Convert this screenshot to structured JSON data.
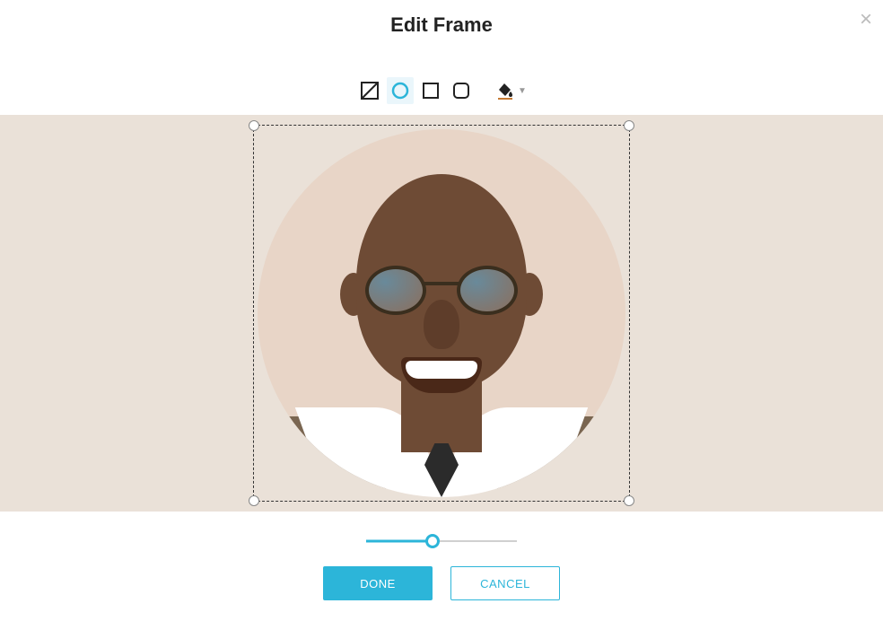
{
  "header": {
    "title": "Edit Frame"
  },
  "shapes": {
    "selected": "circle",
    "options": [
      "none",
      "circle",
      "square",
      "rounded"
    ]
  },
  "color": {
    "accent": "#c67a34"
  },
  "slider": {
    "value": 44
  },
  "buttons": {
    "done": "DONE",
    "cancel": "CANCEL"
  }
}
